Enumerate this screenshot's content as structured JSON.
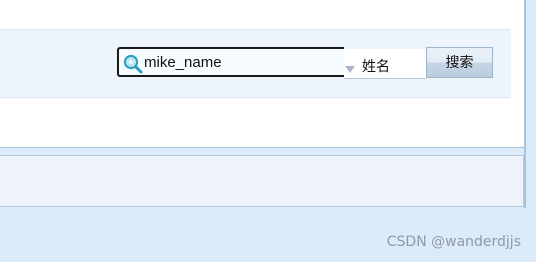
{
  "search": {
    "query_value": "mike_name",
    "field_selected": "姓名",
    "button_label": "搜索"
  },
  "watermark": {
    "text": "CSDN @wanderdjjs"
  },
  "colors": {
    "background": "#dcebf9",
    "toolbar": "#eef4fb",
    "border": "#a9c3d9",
    "icon_accent": "#2a9fbf"
  }
}
